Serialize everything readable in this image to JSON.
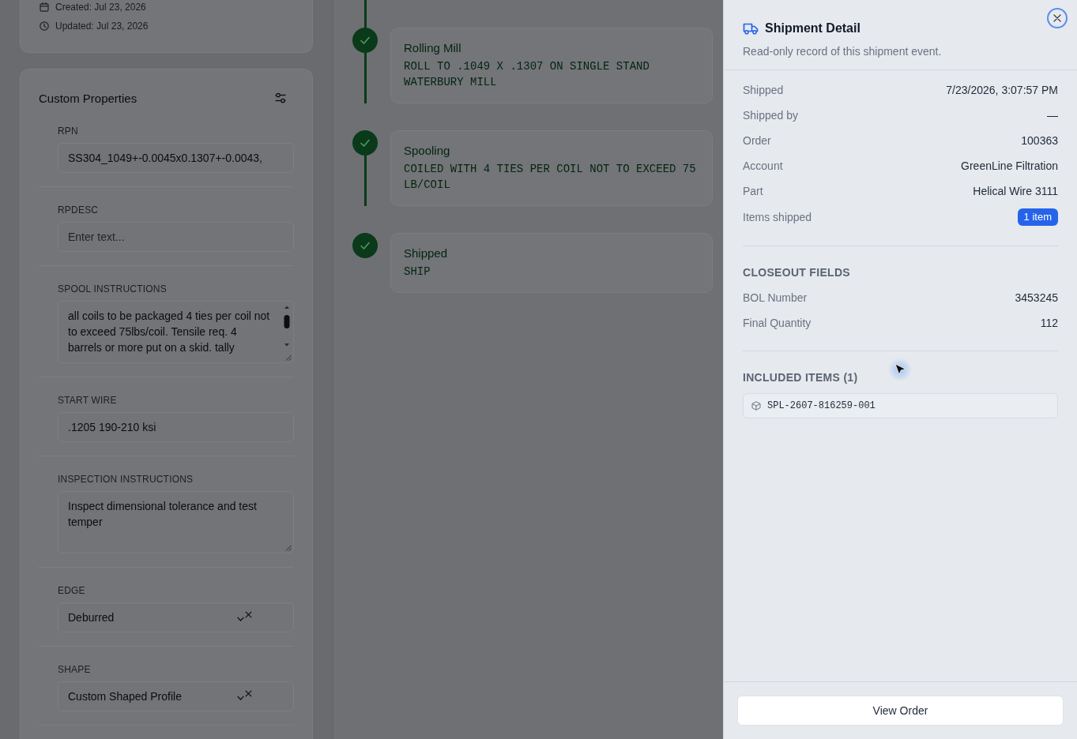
{
  "background": {
    "record_card": {
      "created": "Created: Jul 23, 2026",
      "updated": "Updated: Jul 23, 2026"
    },
    "custom_properties": {
      "title": "Custom Properties",
      "fields": [
        {
          "kind": "input",
          "label": "RPN",
          "value": "SS304_1049+-0.0045x0.1307+-0.0043,"
        },
        {
          "kind": "input",
          "label": "RPDESC",
          "placeholder": "Enter text..."
        },
        {
          "kind": "textarea",
          "label": "SPOOL INSTRUCTIONS",
          "value": "all coils to be packaged 4 ties per coil not to exceed 75lbs/coil. Tensile req. 4 barrels or more put on a skid. tally",
          "scrollbar": true
        },
        {
          "kind": "input",
          "label": "START WIRE",
          "value": ".1205 190-210 ksi"
        },
        {
          "kind": "textarea",
          "label": "INSPECTION INSTRUCTIONS",
          "value": "Inspect dimensional tolerance and test temper",
          "scrollbar": false
        },
        {
          "kind": "select",
          "label": "EDGE",
          "value": "Deburred"
        },
        {
          "kind": "select",
          "label": "SHAPE",
          "value": "Custom Shaped Profile"
        }
      ]
    },
    "timeline": [
      {
        "title": "Rolling Mill",
        "note": "ROLL TO .1049 X .1307 ON SINGLE STAND WATERBURY MILL",
        "done": true
      },
      {
        "title": "Spooling",
        "note": "COILED WITH 4 TIES PER COIL NOT TO EXCEED 75 LB/COIL",
        "done": true
      },
      {
        "title": "Shipped",
        "note": "SHIP",
        "done": true
      }
    ]
  },
  "drawer": {
    "title": "Shipment Detail",
    "subtitle": "Read-only record of this shipment event.",
    "details": [
      {
        "label": "Shipped",
        "value": "7/23/2026, 3:07:57 PM"
      },
      {
        "label": "Shipped by",
        "value": "—"
      },
      {
        "label": "Order",
        "value": "100363"
      },
      {
        "label": "Account",
        "value": "GreenLine Filtration"
      },
      {
        "label": "Part",
        "value": "Helical Wire 3111"
      },
      {
        "label": "Items shipped",
        "badge": "1 item"
      }
    ],
    "closeout": {
      "heading": "CLOSEOUT FIELDS",
      "fields": [
        {
          "label": "BOL Number",
          "value": "3453245"
        },
        {
          "label": "Final Quantity",
          "value": "112"
        }
      ]
    },
    "included": {
      "heading": "INCLUDED ITEMS (1)",
      "items": [
        "SPL-2607-816259-001"
      ]
    },
    "footer_button": "View Order"
  }
}
